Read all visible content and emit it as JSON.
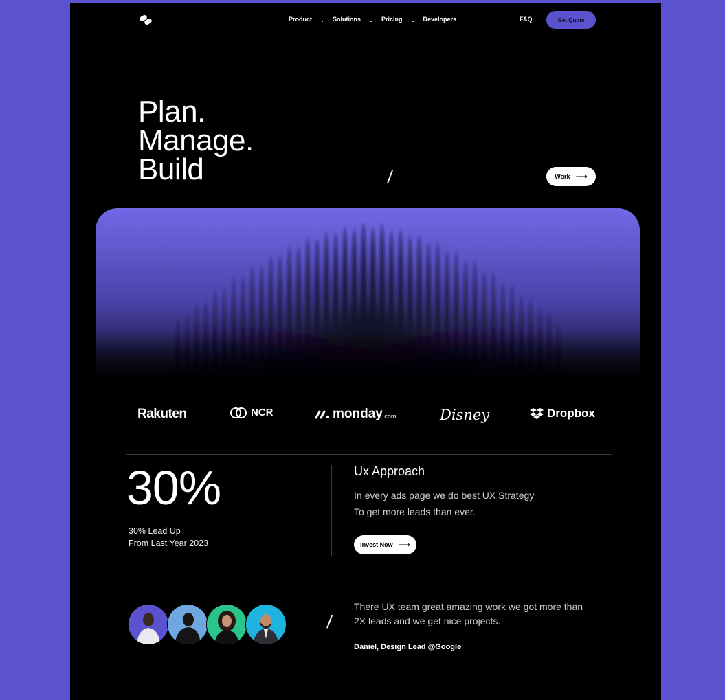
{
  "nav": {
    "logo_icon": "double-pill-logo-icon",
    "items": [
      "Product",
      "Solutions",
      "Pricing",
      "Developers"
    ],
    "faq": "FAQ",
    "cta": "Get Quote"
  },
  "hero": {
    "lines": [
      "Plan.",
      "Manage.",
      "Build"
    ],
    "slash": "/",
    "work_label": "Work",
    "arrow": "⟶"
  },
  "brands": [
    "Rakuten",
    "NCR",
    "monday",
    ".com",
    "Disney",
    "Dropbox"
  ],
  "stats": {
    "value": "30%",
    "caption_line1": "30% Lead Up",
    "caption_line2": "From Last Year 2023"
  },
  "approach": {
    "title": "Ux Approach",
    "line1": "In every ads page we do best UX Strategy",
    "line2": "To get more leads than ever.",
    "button": "Invest Now"
  },
  "testimonial": {
    "slash": "/",
    "line1": "There UX team great amazing work we got more than",
    "line2": "2X leads and we get nice projects.",
    "author": "Daniel, Design Lead @Google"
  },
  "colors": {
    "accent": "#5b52cf",
    "background": "#000000",
    "avatar_bg": [
      "#5b52cf",
      "#6fa8e0",
      "#2bc48a",
      "#1fb4e0"
    ]
  }
}
